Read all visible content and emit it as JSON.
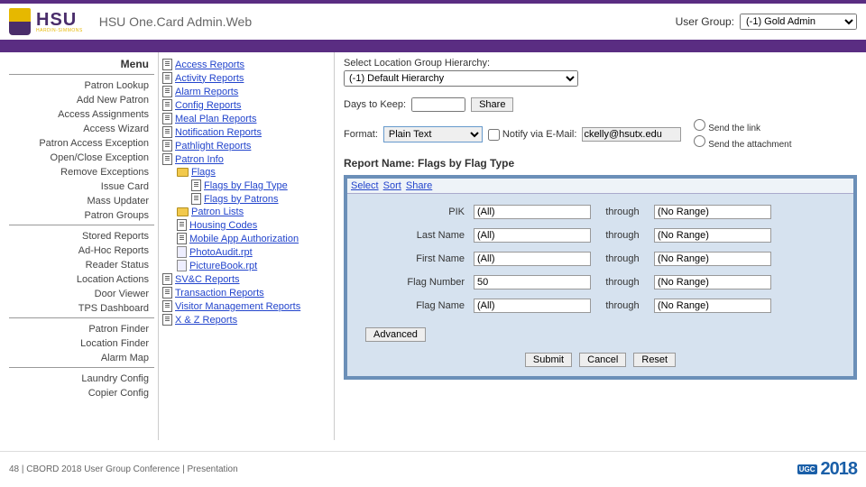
{
  "header": {
    "brand_big": "HSU",
    "brand_small": "HARDIN-SIMMONS",
    "app_title": "HSU One.Card Admin.Web",
    "user_group_label": "User Group:",
    "user_group_value": "(-1) Gold Admin"
  },
  "menu": {
    "title": "Menu",
    "group1": [
      "Patron Lookup",
      "Add New Patron",
      "Access Assignments",
      "Access Wizard",
      "Patron Access Exception",
      "Open/Close Exception",
      "Remove Exceptions",
      "Issue Card",
      "Mass Updater",
      "Patron Groups"
    ],
    "group2": [
      "Stored Reports",
      "Ad-Hoc Reports",
      "Reader Status",
      "Location Actions",
      "Door Viewer",
      "TPS Dashboard"
    ],
    "group3": [
      "Patron Finder",
      "Location Finder",
      "Alarm Map"
    ],
    "group4": [
      "Laundry Config",
      "Copier Config"
    ]
  },
  "tree": {
    "items": [
      {
        "label": "Access Reports",
        "type": "doc"
      },
      {
        "label": "Activity Reports",
        "type": "doc"
      },
      {
        "label": "Alarm Reports",
        "type": "doc"
      },
      {
        "label": "Config Reports",
        "type": "doc"
      },
      {
        "label": "Meal Plan Reports",
        "type": "doc"
      },
      {
        "label": "Notification Reports",
        "type": "doc"
      },
      {
        "label": "Pathlight Reports",
        "type": "doc"
      },
      {
        "label": "Patron Info",
        "type": "doc"
      }
    ],
    "flags_folder": "Flags",
    "flags_children": [
      "Flags by Flag Type",
      "Flags by Patrons"
    ],
    "patron_lists_folder": "Patron Lists",
    "patron_lists_children": [
      {
        "label": "Housing Codes",
        "type": "doc"
      },
      {
        "label": "Mobile App Authorization",
        "type": "doc"
      },
      {
        "label": "PhotoAudit.rpt",
        "type": "rpt"
      },
      {
        "label": "PictureBook.rpt",
        "type": "rpt"
      }
    ],
    "tail": [
      {
        "label": "SV&C Reports",
        "type": "doc"
      },
      {
        "label": "Transaction Reports",
        "type": "doc"
      },
      {
        "label": "Visitor Management Reports",
        "type": "doc"
      },
      {
        "label": "X & Z Reports",
        "type": "doc"
      }
    ]
  },
  "content": {
    "hier_label": "Select Location Group Hierarchy:",
    "hier_value": "(-1) Default Hierarchy",
    "days_label": "Days to Keep:",
    "days_value": "",
    "share_btn": "Share",
    "format_label": "Format:",
    "format_value": "Plain Text",
    "notify_label": "Notify via E-Mail:",
    "email_value": "ckelly@hsutx.edu",
    "radio_link": "Send the link",
    "radio_attach": "Send the attachment",
    "report_name_label": "Report Name: Flags by Flag Type",
    "tabs": [
      "Select",
      "Sort",
      "Share"
    ],
    "params": [
      {
        "label": "PIK",
        "from": "(All)",
        "thru": "through",
        "to": "(No Range)"
      },
      {
        "label": "Last Name",
        "from": "(All)",
        "thru": "through",
        "to": "(No Range)"
      },
      {
        "label": "First Name",
        "from": "(All)",
        "thru": "through",
        "to": "(No Range)"
      },
      {
        "label": "Flag Number",
        "from": "50",
        "thru": "through",
        "to": "(No Range)"
      },
      {
        "label": "Flag Name",
        "from": "(All)",
        "thru": "through",
        "to": "(No Range)"
      }
    ],
    "advanced_btn": "Advanced",
    "submit_btn": "Submit",
    "cancel_btn": "Cancel",
    "reset_btn": "Reset"
  },
  "footer": {
    "text": "48 |  CBORD 2018 User Group Conference | Presentation",
    "ugc_badge": "UGC",
    "ugc_year": "2018"
  }
}
